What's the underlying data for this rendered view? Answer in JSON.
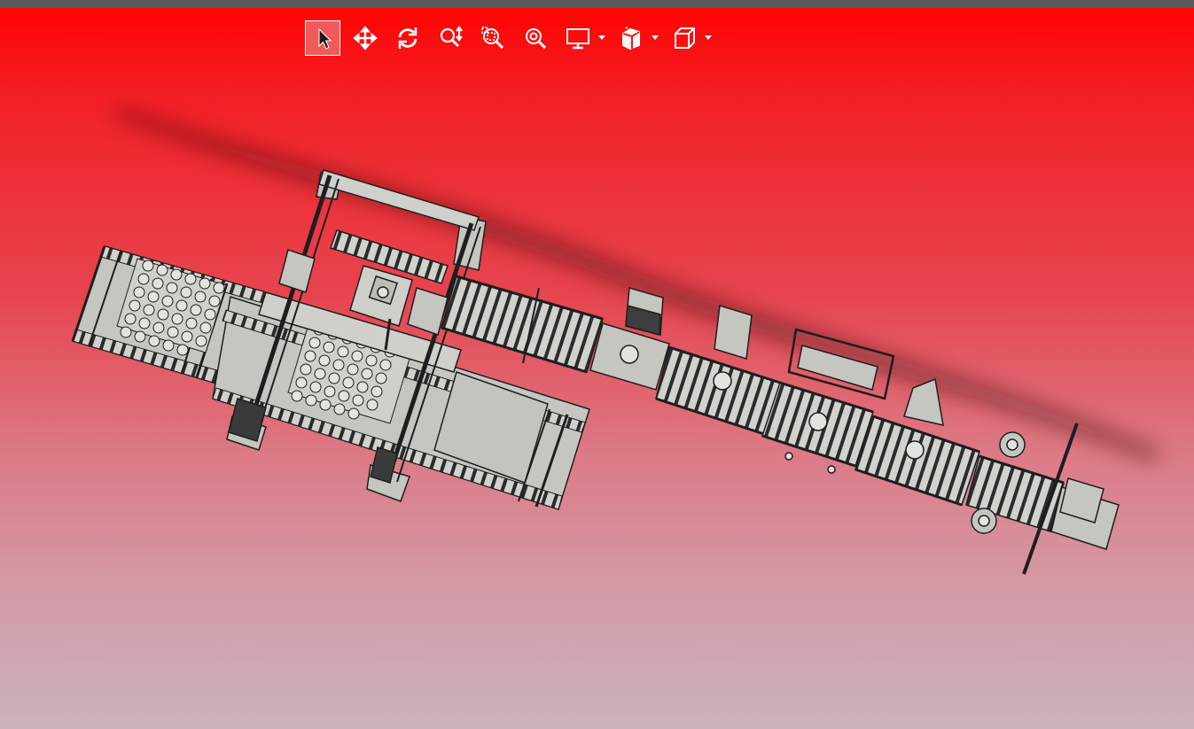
{
  "app": {
    "view": "3d-model-viewer",
    "background": {
      "top": "#ff0303",
      "bottom": "#cbb3bb"
    },
    "model_color": "#c6c6c0"
  },
  "toolbar": {
    "tools": [
      {
        "id": "select",
        "icon": "cursor-arrow-icon",
        "active": true
      },
      {
        "id": "pan",
        "icon": "pan-move-icon",
        "active": false
      },
      {
        "id": "rotate",
        "icon": "rotate-icon",
        "active": false
      },
      {
        "id": "zoom",
        "icon": "zoom-updown-icon",
        "active": false
      },
      {
        "id": "zoom-window",
        "icon": "zoom-window-icon",
        "active": false
      },
      {
        "id": "zoom-fit",
        "icon": "zoom-fit-icon",
        "active": false
      },
      {
        "id": "display",
        "icon": "monitor-icon",
        "dropdown": true
      },
      {
        "id": "section",
        "icon": "section-view-icon",
        "dropdown": true
      },
      {
        "id": "orientation",
        "icon": "cube-view-icon",
        "dropdown": true
      }
    ]
  }
}
